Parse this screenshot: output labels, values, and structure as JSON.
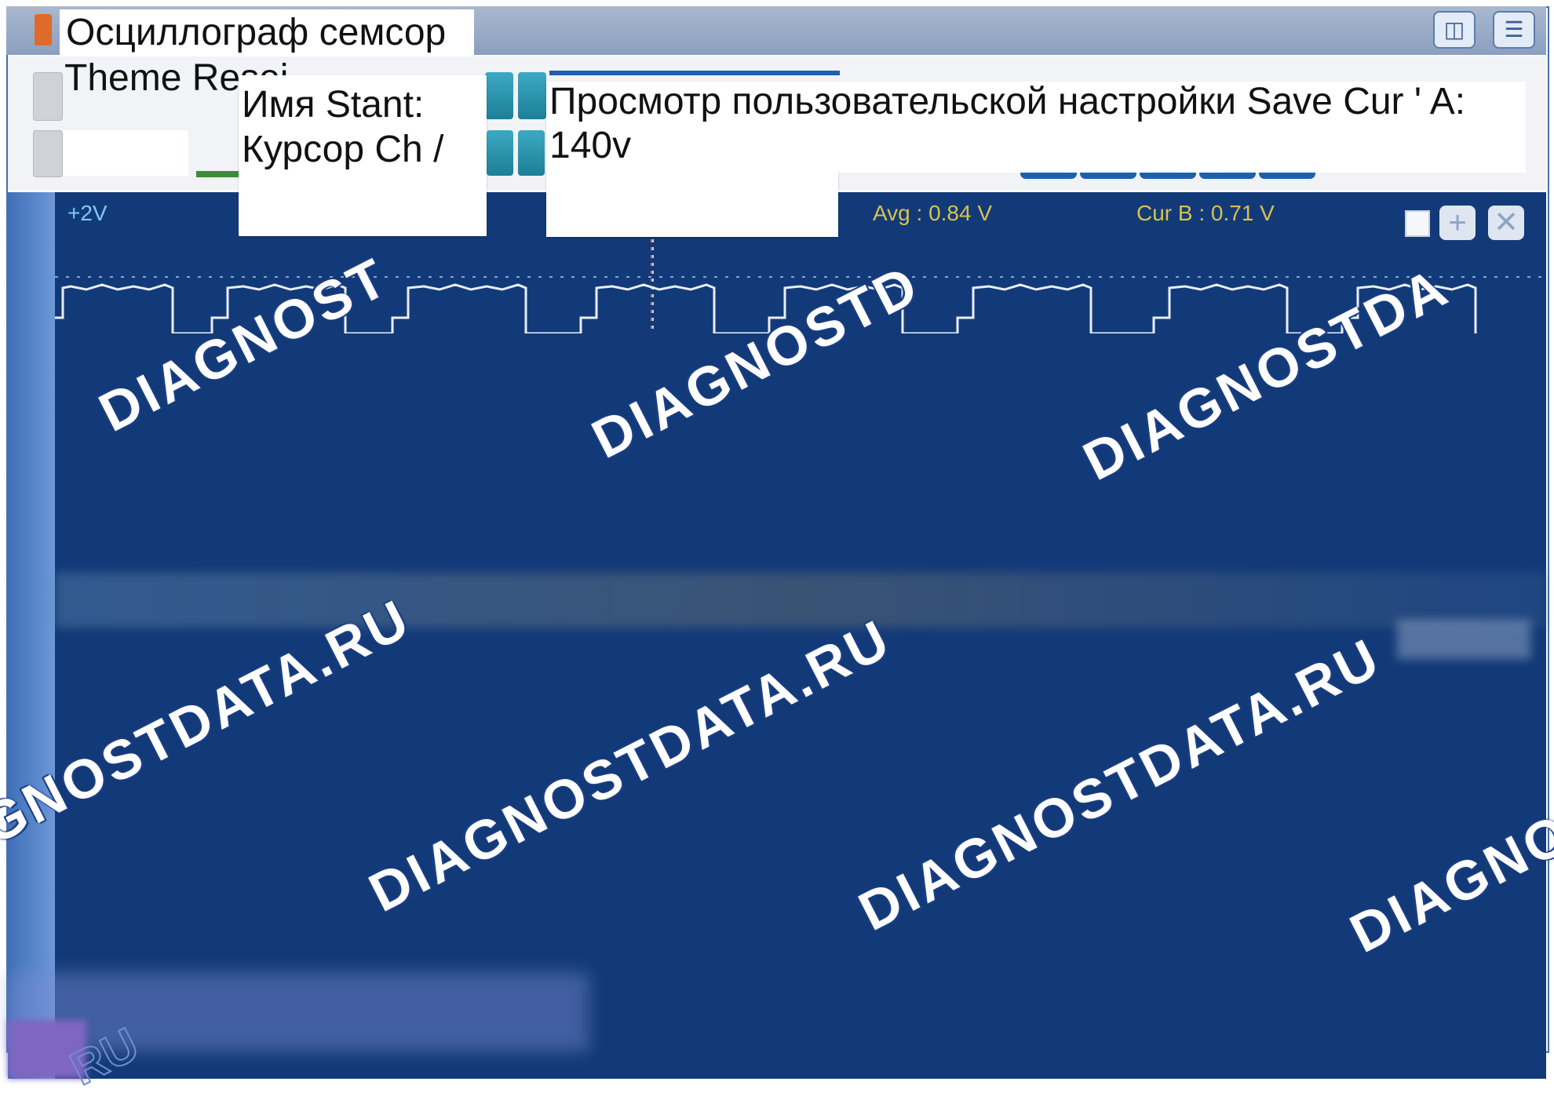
{
  "window": {
    "title": "Осциллограф семсор",
    "theme_label": "Theme Resei"
  },
  "popups": {
    "left": {
      "line1": "Имя Stant:",
      "line2": "Курсор Ch /"
    },
    "right": {
      "line1": "Просмотр пользовательской настройки Save Cur ' A:",
      "line2": "140v"
    }
  },
  "scope": {
    "scale_label": "+2V",
    "avg_label": "Avg : 0.84 V",
    "cursor_b_label": "Cur B : 0.71 V",
    "controls": [
      "maximize-square-icon",
      "plus-icon",
      "close-icon"
    ],
    "trace_color": "#e8eef8",
    "background_color": "#133a78"
  },
  "watermark": {
    "text": "DIAGNOSTDATA.RU",
    "parts": [
      "DIAGNOST",
      "DIAGNOSTD",
      "DIAGNOSTDA",
      "GNOSTDATA.RU",
      "DIAGNOSTDATA.RU",
      "DIAGNO",
      "RU"
    ]
  },
  "colors": {
    "titlebar": "#8a9fbf",
    "teal_button": "#1d7f98",
    "blue_pill": "#1d5fb0",
    "measurement_text": "#d7c14e"
  }
}
